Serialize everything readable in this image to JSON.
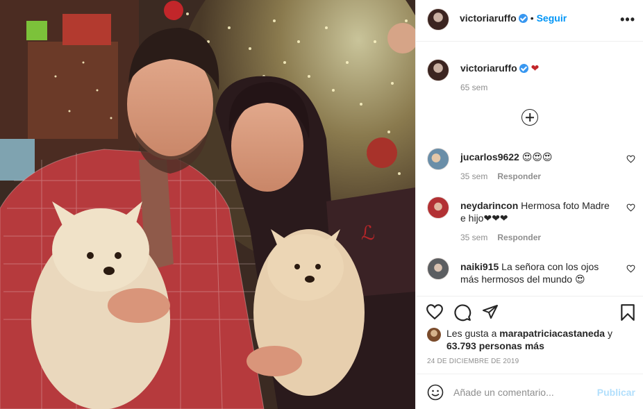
{
  "post": {
    "username": "victoriaruffo",
    "follow_label": "Seguir",
    "dot": "•",
    "more_label": "•••",
    "caption": {
      "username": "victoriaruffo",
      "text": "❤",
      "time": "65 sem"
    }
  },
  "comments": [
    {
      "username": "jucarlos9622",
      "text": "😍😍😍",
      "time": "35 sem",
      "reply": "Responder"
    },
    {
      "username": "neydarincon",
      "text": "Hermosa foto Madre e hijo❤❤❤",
      "time": "35 sem",
      "reply": "Responder"
    },
    {
      "username": "naiki915",
      "text": "La señora con los ojos más hermosos del mundo 😍"
    }
  ],
  "likes": {
    "prefix": "Les gusta a",
    "user": "marapatriciacastaneda",
    "conj": "y",
    "count": "63.793 personas más"
  },
  "date": "24 DE DICIEMBRE DE 2019",
  "add_comment": {
    "placeholder": "Añade un comentario...",
    "publish": "Publicar"
  },
  "colors": {
    "accent": "#0095f6",
    "publish_disabled": "#b2dffc",
    "muted": "#8e8e8e",
    "text": "#262626"
  }
}
